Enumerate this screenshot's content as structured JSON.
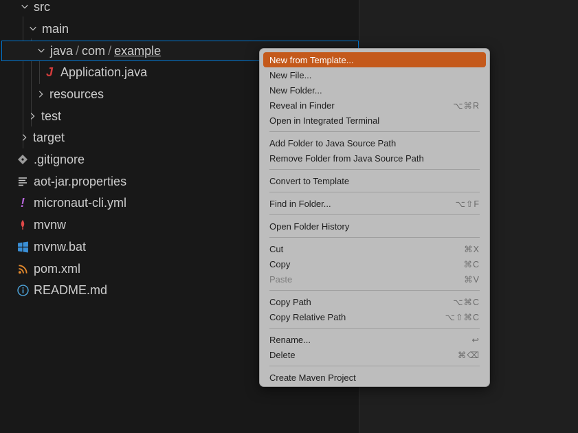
{
  "tree": {
    "src": "src",
    "main": "main",
    "path": {
      "java": "java",
      "sep": "/",
      "com": "com",
      "example": "example"
    },
    "application": "Application.java",
    "resources": "resources",
    "test": "test",
    "target": "target",
    "gitignore": ".gitignore",
    "aot": "aot-jar.properties",
    "micronaut": "micronaut-cli.yml",
    "mvnw": "mvnw",
    "mvnw_bat": "mvnw.bat",
    "pom": "pom.xml",
    "readme": "README.md"
  },
  "icons": {
    "java": "J",
    "yml": "!",
    "info": "i"
  },
  "menu": {
    "new_from_template": "New from Template...",
    "new_file": "New File...",
    "new_folder": "New Folder...",
    "reveal_in_finder": "Reveal in Finder",
    "reveal_shortcut": "⌥⌘R",
    "open_terminal": "Open in Integrated Terminal",
    "add_java_source": "Add Folder to Java Source Path",
    "remove_java_source": "Remove Folder from Java Source Path",
    "convert_template": "Convert to Template",
    "find_in_folder": "Find in Folder...",
    "find_shortcut": "⌥⇧F",
    "open_folder_history": "Open Folder History",
    "cut": "Cut",
    "cut_shortcut": "⌘X",
    "copy": "Copy",
    "copy_shortcut": "⌘C",
    "paste": "Paste",
    "paste_shortcut": "⌘V",
    "copy_path": "Copy Path",
    "copy_path_shortcut": "⌥⌘C",
    "copy_relative_path": "Copy Relative Path",
    "copy_relative_shortcut": "⌥⇧⌘C",
    "rename": "Rename...",
    "rename_shortcut": "↩",
    "delete": "Delete",
    "delete_shortcut": "⌘⌫",
    "create_maven": "Create Maven Project"
  },
  "colors": {
    "highlight": "#c4591b",
    "selection_border": "#0078d4",
    "java": "#d13b3b",
    "yml": "#b565d9",
    "mvnw": "#e04848",
    "windows": "#3a8fd6",
    "rss": "#e58a2d",
    "info": "#4da3d9",
    "git": "#9a9a9a"
  }
}
